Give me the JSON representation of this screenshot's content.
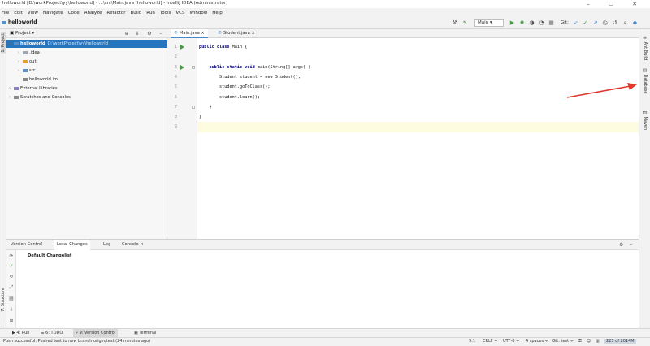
{
  "window": {
    "title": "helloworld [D:\\workProject\\yy\\helloworld] - ...\\src\\Main.java [helloworld] - IntelliJ IDEA (Administrator)",
    "minimize": "–",
    "maximize": "☐",
    "close": "✕"
  },
  "menu": [
    "File",
    "Edit",
    "View",
    "Navigate",
    "Code",
    "Analyze",
    "Refactor",
    "Build",
    "Run",
    "Tools",
    "VCS",
    "Window",
    "Help"
  ],
  "navbar": {
    "breadcrumb": "helloworld",
    "run_config": "Main",
    "git_label": "Git:"
  },
  "project_panel": {
    "title": "Project",
    "tree": [
      {
        "indent": 0,
        "arrow": "▾",
        "label": "helloworld",
        "path": "D:\\workProject\\yy\\helloworld",
        "type": "module",
        "selected": true
      },
      {
        "indent": 1,
        "arrow": "›",
        "label": ".idea",
        "path": "",
        "type": "folder",
        "selected": false
      },
      {
        "indent": 1,
        "arrow": "›",
        "label": "out",
        "path": "",
        "type": "folder-orange",
        "selected": false
      },
      {
        "indent": 1,
        "arrow": "›",
        "label": "src",
        "path": "",
        "type": "folder-blue",
        "selected": false
      },
      {
        "indent": 1,
        "arrow": "",
        "label": "helloworld.iml",
        "path": "",
        "type": "file",
        "selected": false
      },
      {
        "indent": 0,
        "arrow": "›",
        "label": "External Libraries",
        "path": "",
        "type": "library",
        "selected": false
      },
      {
        "indent": 0,
        "arrow": "›",
        "label": "Scratches and Consoles",
        "path": "",
        "type": "scratch",
        "selected": false
      }
    ]
  },
  "editor": {
    "tabs": [
      {
        "label": "Main.java",
        "active": true
      },
      {
        "label": "Student.java",
        "active": false
      }
    ],
    "tab_close": "×",
    "line_numbers": [
      "1",
      "2",
      "3",
      "4",
      "5",
      "6",
      "7",
      "8",
      "9"
    ],
    "lines": [
      {
        "kw": "public class",
        "rest": " Main {"
      },
      {
        "kw": "",
        "rest": ""
      },
      {
        "kw": "    public static void",
        "rest": " main(String[] args) {"
      },
      {
        "kw": "",
        "rest": "        Student student = new Student();"
      },
      {
        "kw": "",
        "rest": "        student.goToClass();"
      },
      {
        "kw": "",
        "rest": "        student.learn();"
      },
      {
        "kw": "",
        "rest": "    }"
      },
      {
        "kw": "",
        "rest": "}"
      },
      {
        "kw": "",
        "rest": ""
      }
    ]
  },
  "left_stripe": {
    "project": "1: Project",
    "structure": "7: Structure",
    "favorites": "2: Favorites"
  },
  "right_stripe": {
    "ant": "Ant Build",
    "database": "Database",
    "maven": "Maven"
  },
  "bottom_panel": {
    "tabs": [
      {
        "label": "Version Control",
        "active": false
      },
      {
        "label": "Local Changes",
        "active": true
      },
      {
        "label": "Log",
        "active": false
      },
      {
        "label": "Console",
        "active": false
      }
    ],
    "changelist": "Default Changelist"
  },
  "tool_windows": [
    {
      "label": "▶ 4: Run",
      "active": false
    },
    {
      "label": "☰ 6: TODO",
      "active": false
    },
    {
      "label": "⑂ 9: Version Control",
      "active": true
    },
    {
      "label": "▣ Terminal",
      "active": false
    }
  ],
  "status": {
    "message": "Push successful: Pushed test to new branch origin/test (24 minutes ago)",
    "position": "9:1",
    "line_sep": "CRLF ÷",
    "encoding": "UTF-8 ÷",
    "indent": "4 spaces ÷",
    "git_branch": "Git: test ÷",
    "memory": "225 of 2014M"
  },
  "colors": {
    "selection": "#2675bf",
    "run_green": "#4a9b45",
    "arrow_red": "#e0382f"
  }
}
